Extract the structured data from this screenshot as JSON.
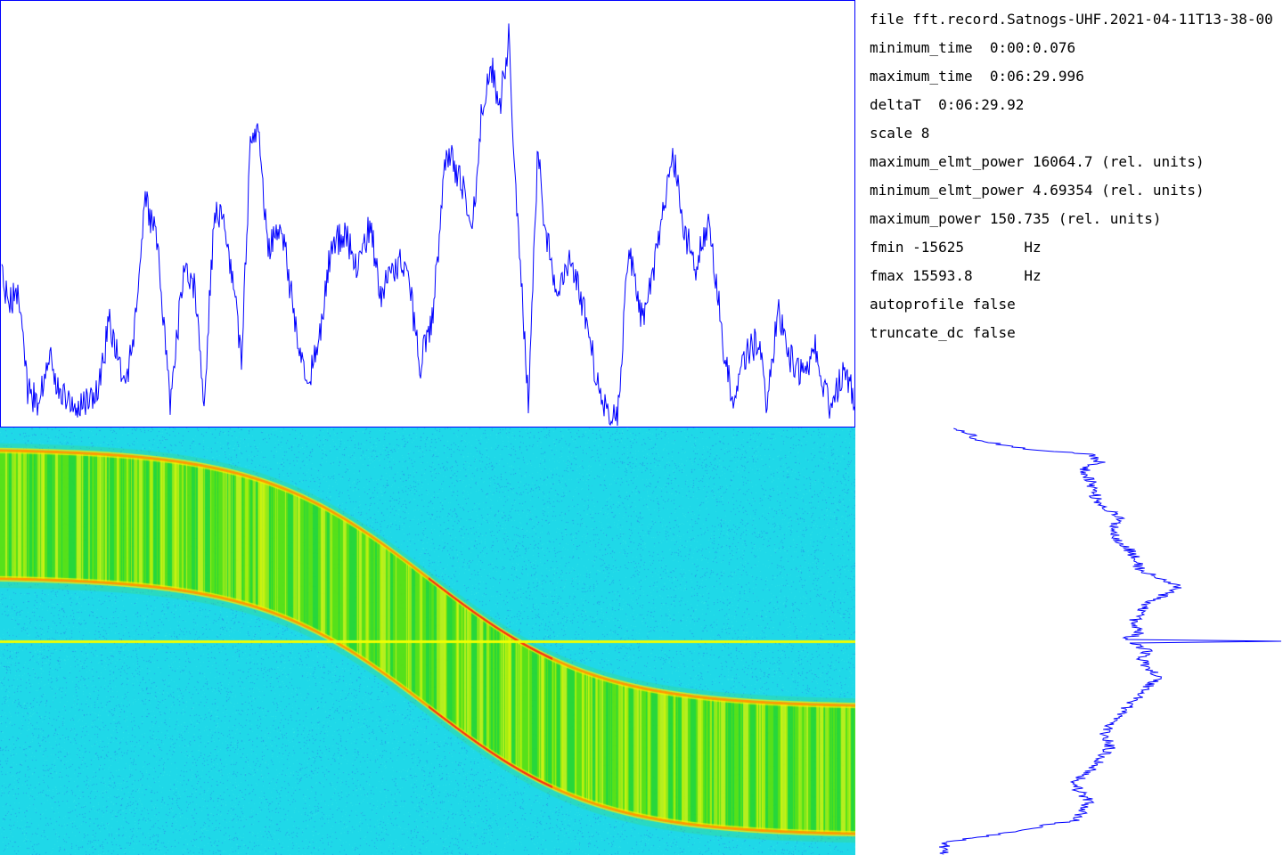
{
  "info": {
    "file_line": "file fft.record.Satnogs-UHF.2021-04-11T13-38-00",
    "minimum_time_line": "minimum_time  0:00:0.076",
    "maximum_time_line": "maximum_time  0:06:29.996",
    "deltaT_line": "deltaT  0:06:29.92",
    "scale_line": "scale 8",
    "maximum_elmt_power_line": "maximum_elmt_power 16064.7 (rel. units)",
    "minimum_elmt_power_line": "minimum_elmt_power 4.69354 (rel. units)",
    "maximum_power_line": "maximum_power 150.735 (rel. units)",
    "fmin_line": "fmin -15625       Hz",
    "fmax_line": "fmax 15593.8      Hz",
    "autoprofile_line": "autoprofile false",
    "truncate_dc_line": "truncate_dc false"
  },
  "colors": {
    "profile_line": "#0000ff",
    "waterfall_background": "#1fd8e8",
    "signal_band": "#3fe010",
    "signal_trace": "#ff4000",
    "dc_line": "#f0ff00"
  },
  "panels": {
    "time_profile": "time-power profile (blue line plot)",
    "waterfall": "spectrogram waterfall (jet colormap)",
    "frequency_profile": "frequency-power profile (blue line plot)"
  }
}
